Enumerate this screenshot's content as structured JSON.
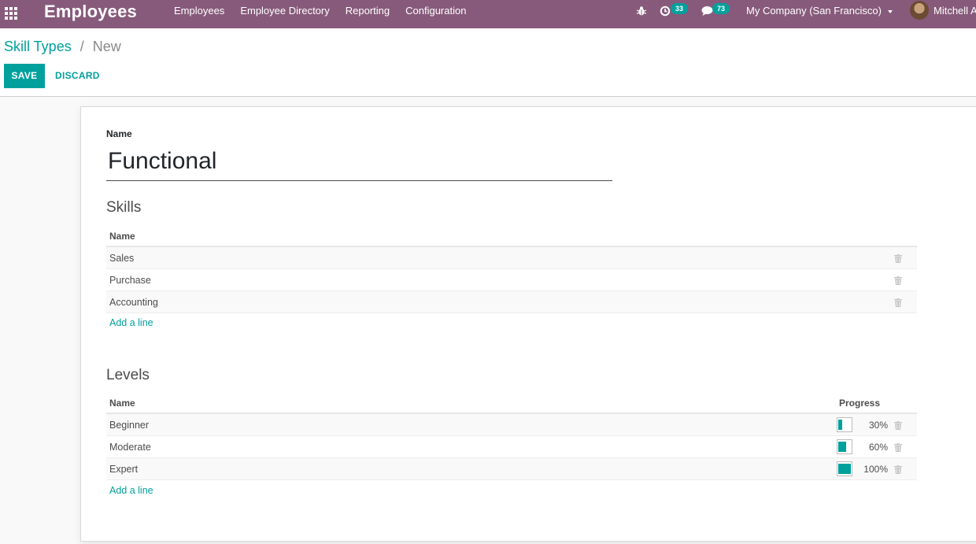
{
  "navbar": {
    "app_name": "Employees",
    "menu": [
      "Employees",
      "Employee Directory",
      "Reporting",
      "Configuration"
    ],
    "activity_count": "33",
    "message_count": "73",
    "company": "My Company (San Francisco)",
    "user": "Mitchell A",
    "accent": "#875a7b"
  },
  "breadcrumb": {
    "parent": "Skill Types",
    "separator": "/",
    "current": "New"
  },
  "buttons": {
    "save": "SAVE",
    "discard": "DISCARD"
  },
  "form": {
    "name_label": "Name",
    "name_value": "Functional",
    "skills": {
      "title": "Skills",
      "header_name": "Name",
      "rows": [
        "Sales",
        "Purchase",
        "Accounting"
      ],
      "add_line": "Add a line"
    },
    "levels": {
      "title": "Levels",
      "header_name": "Name",
      "header_progress": "Progress",
      "rows": [
        {
          "name": "Beginner",
          "progress": 30,
          "progress_label": "30%"
        },
        {
          "name": "Moderate",
          "progress": 60,
          "progress_label": "60%"
        },
        {
          "name": "Expert",
          "progress": 100,
          "progress_label": "100%"
        }
      ],
      "add_line": "Add a line"
    }
  },
  "colors": {
    "primary": "#00a09d",
    "navbar": "#875a7b"
  },
  "icons": [
    "apps-grid-icon",
    "bug-icon",
    "activity-clock-icon",
    "chat-bubble-icon",
    "caret-down-icon",
    "trash-icon"
  ]
}
